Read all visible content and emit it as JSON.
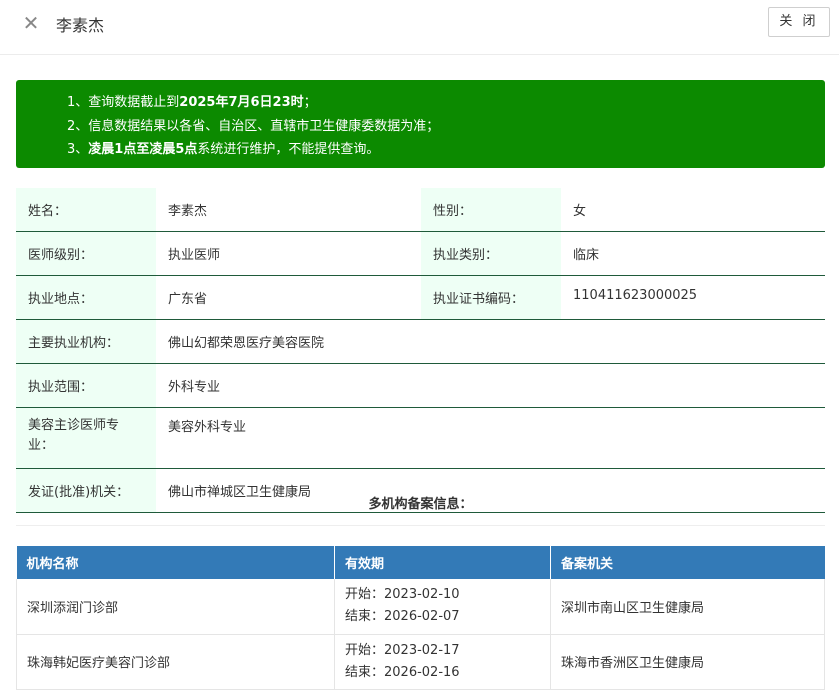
{
  "header": {
    "title": "李素杰",
    "close_label": "关 闭"
  },
  "notice": {
    "lines": [
      {
        "prefix": "1、查询数据截止到",
        "bold": "2025年7月6日23时",
        "suffix": "；"
      },
      {
        "prefix": "2、信息数据结果以各省、自治区、直辖市卫生健康委数据为准；",
        "bold": "",
        "suffix": ""
      },
      {
        "prefix": "3、",
        "bold": "凌晨1点至凌晨5点",
        "suffix": "系统进行维护，不能提供查询。"
      }
    ]
  },
  "info": {
    "name_label": "姓名：",
    "name": "李素杰",
    "gender_label": "性别：",
    "gender": "女",
    "level_label": "医师级别：",
    "level": "执业医师",
    "category_label": "执业类别：",
    "category": "临床",
    "location_label": "执业地点：",
    "location": "广东省",
    "cert_label": "执业证书编码：",
    "cert": "110411623000025",
    "institution_label": "主要执业机构：",
    "institution": "佛山幻都荣恩医疗美容医院",
    "scope_label": "执业范围：",
    "scope": "外科专业",
    "cosmetic_label": "美容主诊医师专业：",
    "cosmetic": "美容外科专业",
    "authority_label": "发证(批准)机关：",
    "authority": "佛山市禅城区卫生健康局"
  },
  "multi": {
    "title": "多机构备案信息：",
    "headers": [
      "机构名称",
      "有效期",
      "备案机关"
    ],
    "rows": [
      {
        "name": "深圳添润门诊部",
        "start": "开始：2023-02-10",
        "end": "结束：2026-02-07",
        "authority": "深圳市南山区卫生健康局"
      },
      {
        "name": "珠海韩妃医疗美容门诊部",
        "start": "开始：2023-02-17",
        "end": "结束：2026-02-16",
        "authority": "珠海市香洲区卫生健康局"
      }
    ]
  }
}
